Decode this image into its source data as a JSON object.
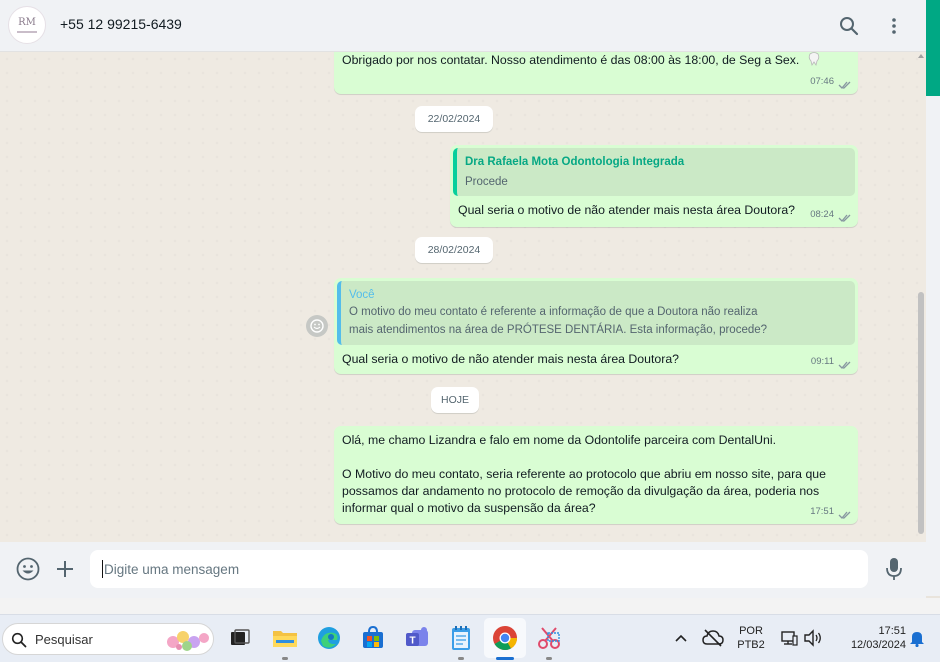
{
  "header": {
    "avatar_monogram": "RM",
    "contact_name": "+55 12 99215-6439",
    "search_icon": "search-icon",
    "menu_icon": "more-vertical-icon"
  },
  "messages": [
    {
      "text": "Obrigado por nos contatar. Nosso atendimento é das 08:00 às 18:00, de Seg a Sex.",
      "time": "07:46",
      "status": "read"
    },
    {
      "date": "22/02/2024"
    },
    {
      "quote_author": "Dra Rafaela Mota Odontologia Integrada",
      "quote_text": "Procede",
      "text": "Qual seria o motivo de não atender mais nesta área Doutora?",
      "time": "08:24",
      "status": "read"
    },
    {
      "date": "28/02/2024"
    },
    {
      "quote_author": "Você",
      "quote_text_line1": "O motivo do meu contato é referente a informação de que a Doutora não realiza",
      "quote_text_line2": "mais atendimentos na área de PRÓTESE DENTÁRIA. Esta informação, procede?",
      "text": "Qual seria o motivo de não atender mais nesta área Doutora?",
      "time": "09:11",
      "status": "read"
    },
    {
      "date": "HOJE"
    },
    {
      "line1": "Olá, me chamo Lizandra e falo em nome da Odontolife parceira com DentalUni.",
      "line2": "O Motivo do meu contato, seria referente ao protocolo que abriu em nosso site, para que",
      "line3": "possamos dar andamento no protocolo de remoção da divulgação da área, poderia nos",
      "line4": "informar qual o motivo da suspensão da área?",
      "time": "17:51",
      "status": "read"
    }
  ],
  "composer": {
    "placeholder": "Digite uma mensagem",
    "emoji_icon": "emoji-icon",
    "attach_icon": "plus-icon",
    "mic_icon": "microphone-icon"
  },
  "taskbar": {
    "search_label": "Pesquisar",
    "lang_line1": "POR",
    "lang_line2": "PTB2",
    "clock_time": "17:51",
    "clock_date": "12/03/2024"
  },
  "colors": {
    "accent": "#00a884",
    "bubble_out": "#d9fdd3",
    "quote_bg": "#cbe9c6"
  }
}
